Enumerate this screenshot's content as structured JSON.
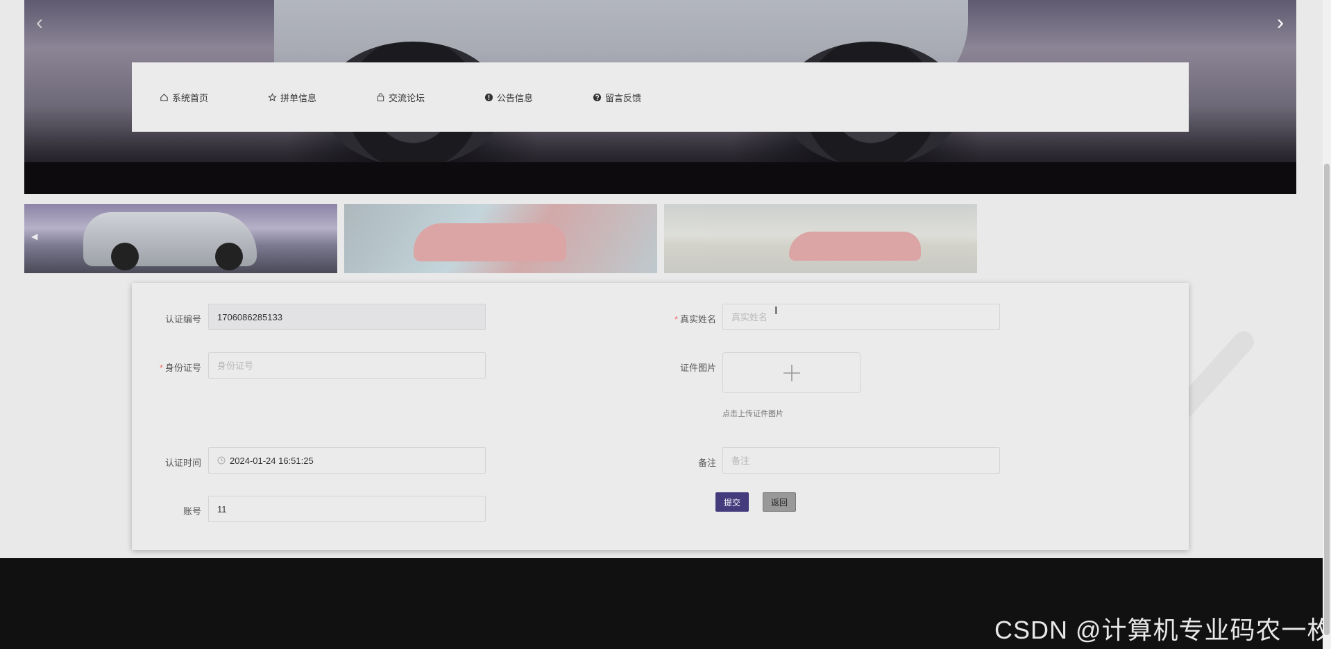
{
  "nav": {
    "items": [
      {
        "label": "系统首页",
        "icon": "home-icon"
      },
      {
        "label": "拼单信息",
        "icon": "star-icon"
      },
      {
        "label": "交流论坛",
        "icon": "bag-icon"
      },
      {
        "label": "公告信息",
        "icon": "info-circle-icon"
      },
      {
        "label": "留言反馈",
        "icon": "question-circle-icon"
      }
    ]
  },
  "carousel": {
    "prev_glyph": "‹",
    "next_glyph": "›"
  },
  "form": {
    "cert_no": {
      "label": "认证编号",
      "value": "1706086285133"
    },
    "real_name": {
      "label": "真实姓名",
      "placeholder": "真实姓名",
      "required": true
    },
    "id_no": {
      "label": "身份证号",
      "placeholder": "身份证号",
      "required": true
    },
    "cert_image": {
      "label": "证件图片",
      "tip": "点击上传证件图片"
    },
    "cert_time": {
      "label": "认证时间",
      "value": "2024-01-24 16:51:25"
    },
    "remark": {
      "label": "备注",
      "placeholder": "备注"
    },
    "account": {
      "label": "账号",
      "value": "11"
    },
    "required_mark": "*",
    "submit_label": "提交",
    "back_label": "返回"
  },
  "watermark": "CSDN @计算机专业码农一枚",
  "colors": {
    "primary_button": "#433b7c",
    "required": "#f56c6c",
    "footer": "#121112"
  }
}
